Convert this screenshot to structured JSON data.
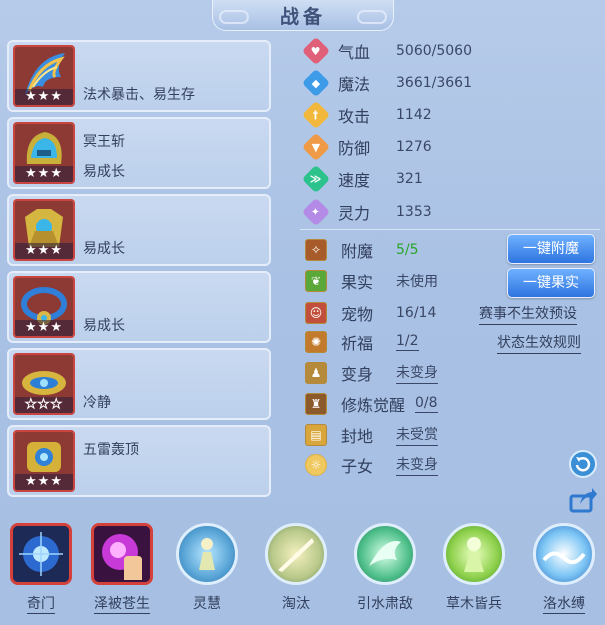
{
  "title": "战备",
  "equipment": [
    {
      "line1": "",
      "line2": "法术暴击、易生存",
      "stars": 3
    },
    {
      "line1": "冥王斩",
      "line2": "易成长",
      "stars": 3
    },
    {
      "line1": "",
      "line2": "易成长",
      "stars": 3
    },
    {
      "line1": "",
      "line2": "易成长",
      "stars": 3
    },
    {
      "line1": "",
      "line2": "冷静",
      "stars": 0
    },
    {
      "line1": "五雷轰顶",
      "line2": "",
      "stars": 3
    }
  ],
  "stats": [
    {
      "label": "气血",
      "value": "5060/5060",
      "icon": "heart-icon",
      "color": "#e0607a"
    },
    {
      "label": "魔法",
      "value": "3661/3661",
      "icon": "mana-icon",
      "color": "#3d9be8"
    },
    {
      "label": "攻击",
      "value": "1142",
      "icon": "attack-icon",
      "color": "#f2b83c"
    },
    {
      "label": "防御",
      "value": "1276",
      "icon": "shield-icon",
      "color": "#ef9a46"
    },
    {
      "label": "速度",
      "value": "321",
      "icon": "speed-icon",
      "color": "#2cc28c"
    },
    {
      "label": "灵力",
      "value": "1353",
      "icon": "spirit-icon",
      "color": "#b38ae6"
    }
  ],
  "status": {
    "enchant": {
      "label": "附魔",
      "value": "5/5",
      "value_color": "#2aa52a"
    },
    "fruit": {
      "label": "果实",
      "value": "未使用"
    },
    "pet": {
      "label": "宠物",
      "value": "16/14"
    },
    "blessing": {
      "label": "祈福",
      "value": "1/2"
    },
    "transform": {
      "label": "变身",
      "value": "未变身"
    },
    "awaken": {
      "label": "修炼觉醒",
      "value": "0/8"
    },
    "territory": {
      "label": "封地",
      "value": "未受赏"
    },
    "child": {
      "label": "子女",
      "value": "未变身"
    }
  },
  "buttons": {
    "enchant_all": "一键附魔",
    "fruit_all": "一键果实"
  },
  "links": {
    "event_preset": "赛事不生效预设",
    "status_rules": "状态生效规则"
  },
  "skills": [
    {
      "label": "奇门",
      "style": "square",
      "underline": true
    },
    {
      "label": "泽被苍生",
      "style": "square",
      "underline": true
    },
    {
      "label": "灵慧",
      "style": "round",
      "underline": false
    },
    {
      "label": "淘汰",
      "style": "round",
      "underline": false
    },
    {
      "label": "引水肃敌",
      "style": "round",
      "underline": false
    },
    {
      "label": "草木皆兵",
      "style": "round",
      "underline": false
    },
    {
      "label": "洛水缚",
      "style": "round",
      "underline": false
    }
  ],
  "colors": {
    "panel_bg": "#b6cbe9",
    "card_border": "#c9453f",
    "button_blue": "#2d74e0"
  }
}
